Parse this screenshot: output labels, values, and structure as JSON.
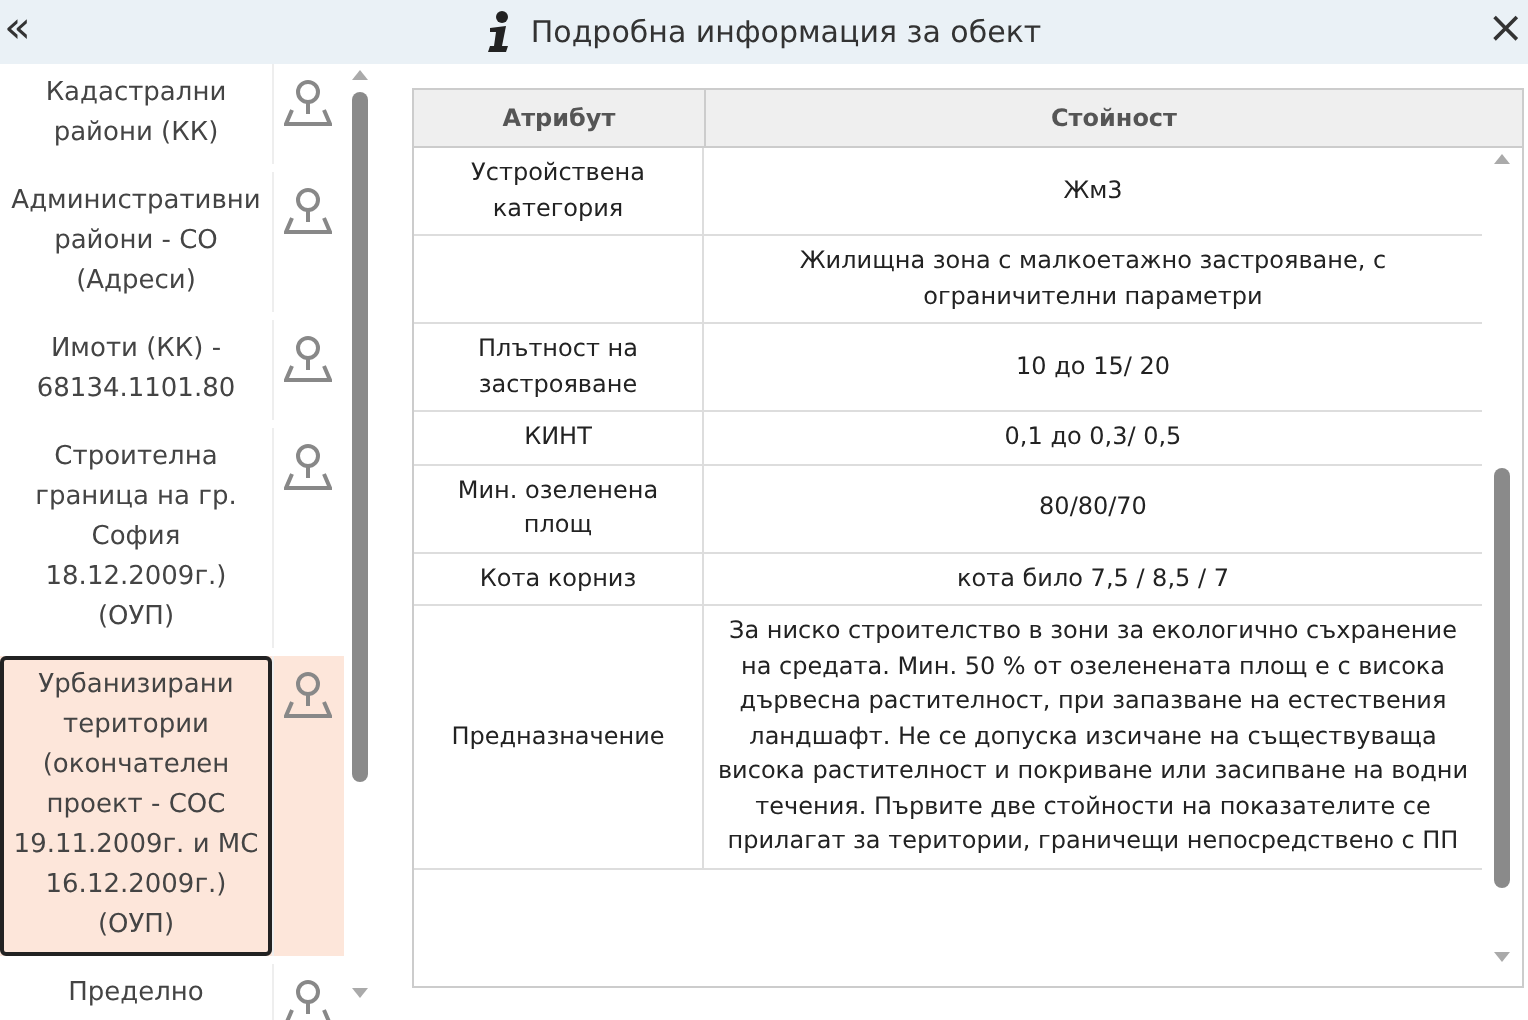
{
  "header": {
    "collapse": "«",
    "title": "Подробна информация за обект",
    "close": "×"
  },
  "layers": [
    {
      "label": "Кадастрални райони (КК)",
      "selected": false
    },
    {
      "label": "Административни райони - СО (Адреси)",
      "selected": false
    },
    {
      "label": "Имоти (КК) - 68134.1101.80",
      "selected": false
    },
    {
      "label": "Строителна граница на гр. София 18.12.2009г.) (ОУП)",
      "selected": false
    },
    {
      "label": "Урбанизирани територии (окончателен проект - СОС 19.11.2009г. и МС 16.12.2009г.) (ОУП)",
      "selected": true
    },
    {
      "label": "Пределно",
      "selected": false
    }
  ],
  "table": {
    "columns": [
      "Атрибут",
      "Стойност"
    ],
    "rows": [
      {
        "attribute": "Устройствена категория",
        "value": "Жм3"
      },
      {
        "attribute": "",
        "value": "Жилищна зона с малкоетажно застрояване, с ограничителни параметри"
      },
      {
        "attribute": "Плътност на застрояване",
        "value": "10 до 15/ 20"
      },
      {
        "attribute": "КИНТ",
        "value": "0,1 до 0,3/ 0,5"
      },
      {
        "attribute": "Мин. озеленена площ",
        "value": "80/80/70"
      },
      {
        "attribute": "Кота корниз",
        "value": "кота било 7,5 / 8,5 / 7"
      },
      {
        "attribute": "Предназначение",
        "value": "За ниско строителство в зони за екологично съхранение на средата. Мин. 50 % от озеленената площ е с висока дървесна растителност, при запазване на естествения ландшафт. Не се допуска изсичане на съществуваща висока растителност и покриване или засипване на водни течения. Първите две стойности на показателите се прилагат за територии, граничещи непосредствено с ПП"
      }
    ]
  }
}
